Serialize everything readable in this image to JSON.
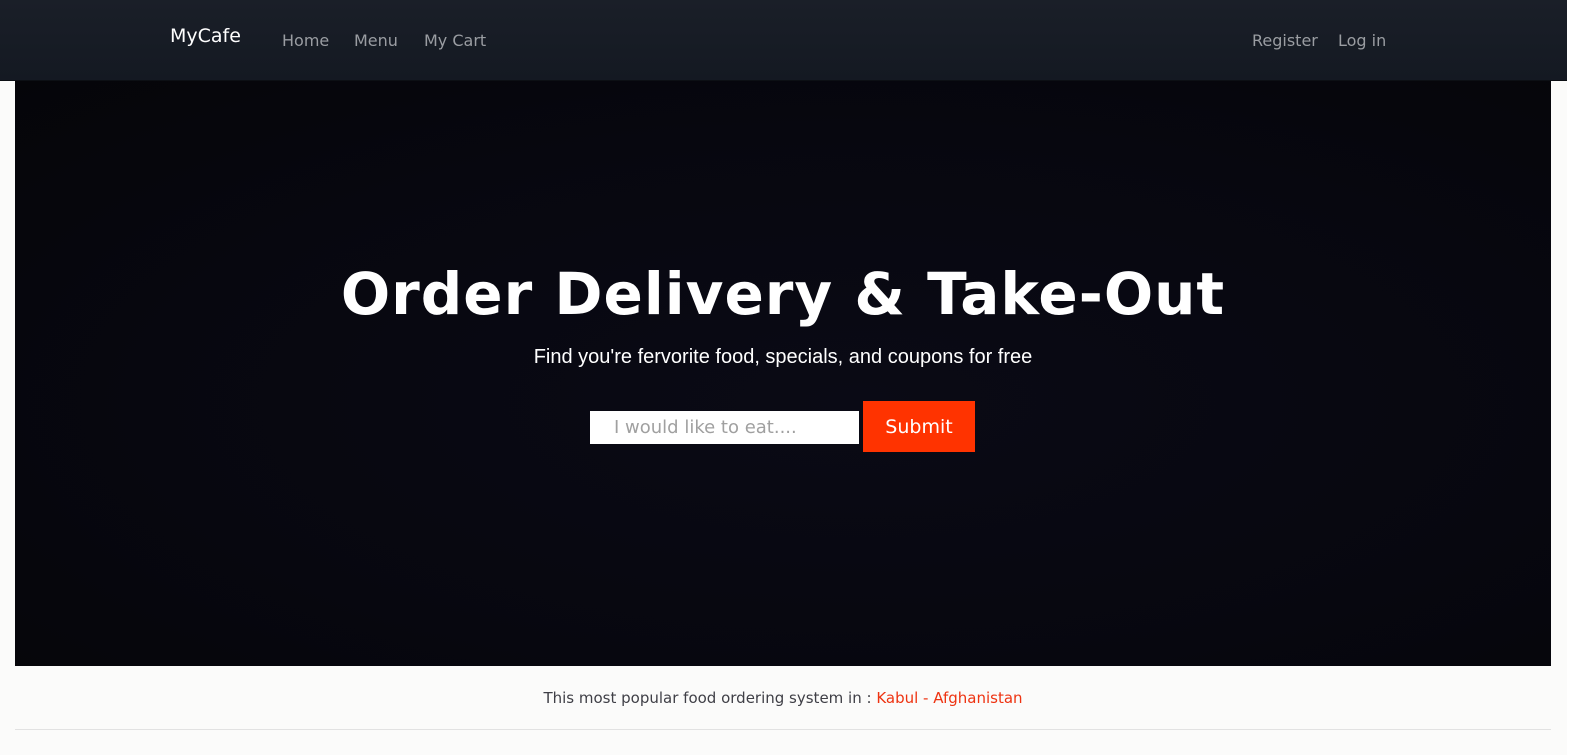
{
  "navbar": {
    "brand": "MyCafe",
    "left_links": [
      "Home",
      "Menu",
      "My Cart"
    ],
    "right_links": [
      "Register",
      "Log in"
    ]
  },
  "hero": {
    "title": "Order Delivery & Take-Out",
    "subtitle": "Find you're fervorite food, specials, and coupons for free",
    "search": {
      "placeholder": "I would like to eat....",
      "value": ""
    },
    "submit_label": "Submit"
  },
  "footer": {
    "text": "This most popular food ordering system in : ",
    "location": "Kabul - Afghanistan"
  },
  "colors": {
    "navbar_bg": "#161b23",
    "hero_bg": "#07070f",
    "accent": "#ff3300",
    "location_text": "#ee3311"
  }
}
